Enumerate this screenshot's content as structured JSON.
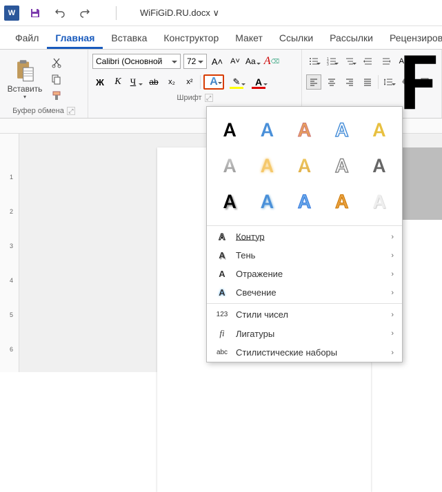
{
  "app": {
    "letter": "W"
  },
  "document": {
    "title": "WiFiGiD.RU.docx ∨"
  },
  "tabs": {
    "file": "Файл",
    "home": "Главная",
    "insert": "Вставка",
    "design": "Конструктор",
    "layout": "Макет",
    "references": "Ссылки",
    "mailings": "Рассылки",
    "review": "Рецензирование"
  },
  "ribbon": {
    "paste": "Вставить",
    "clipboard_label": "Буфер обмена",
    "font_label": "Шрифт",
    "font_name": "Calibri (Основной",
    "font_size": "72",
    "bold": "Ж",
    "italic": "К",
    "underline": "Ч",
    "strike": "ab",
    "sub": "x₂",
    "sup": "x²",
    "grow": "A˄",
    "shrink": "A˅",
    "case": "Aa",
    "clear": "A⌫",
    "text_effects_glyph": "A",
    "highlight_glyph": "✎",
    "font_color_glyph": "A"
  },
  "dropdown": {
    "glyph": "A",
    "outline": "Контур",
    "shadow": "Тень",
    "reflection": "Отражение",
    "glow": "Свечение",
    "number_styles": "Стили чисел",
    "ligatures": "Лигатуры",
    "stylistic_sets": "Стилистические наборы",
    "icon_outline": "A",
    "icon_shadow": "A",
    "icon_reflection": "A",
    "icon_glow": "A",
    "icon_numbers": "123",
    "icon_ligatures": "fi",
    "icon_sets": "abc"
  },
  "canvas": {
    "letter": "F"
  }
}
